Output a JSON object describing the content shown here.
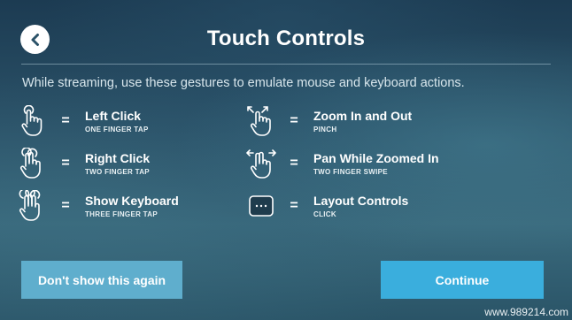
{
  "header": {
    "title": "Touch Controls",
    "back_icon": "chevron-left-icon"
  },
  "intro": "While streaming, use these gestures to emulate mouse and keyboard actions.",
  "equals": "=",
  "gestures": [
    {
      "name": "Left Click",
      "sub": "ONE FINGER TAP",
      "icon": "one-finger-tap-icon"
    },
    {
      "name": "Right Click",
      "sub": "TWO FINGER TAP",
      "icon": "two-finger-tap-icon"
    },
    {
      "name": "Show Keyboard",
      "sub": "THREE FINGER TAP",
      "icon": "three-finger-tap-icon"
    },
    {
      "name": "Zoom In and Out",
      "sub": "PINCH",
      "icon": "pinch-icon"
    },
    {
      "name": "Pan While Zoomed In",
      "sub": "TWO FINGER SWIPE",
      "icon": "two-finger-swipe-icon"
    },
    {
      "name": "Layout Controls",
      "sub": "CLICK",
      "icon": "layout-controls-icon"
    }
  ],
  "buttons": {
    "dont_show": "Don't show this again",
    "continue": "Continue"
  },
  "watermark": "www.989214.com",
  "colors": {
    "secondary_button": "#5faecd",
    "primary_button": "#3aaedd",
    "back_button_bg": "#ffffff",
    "back_button_arrow": "#2b5268"
  }
}
